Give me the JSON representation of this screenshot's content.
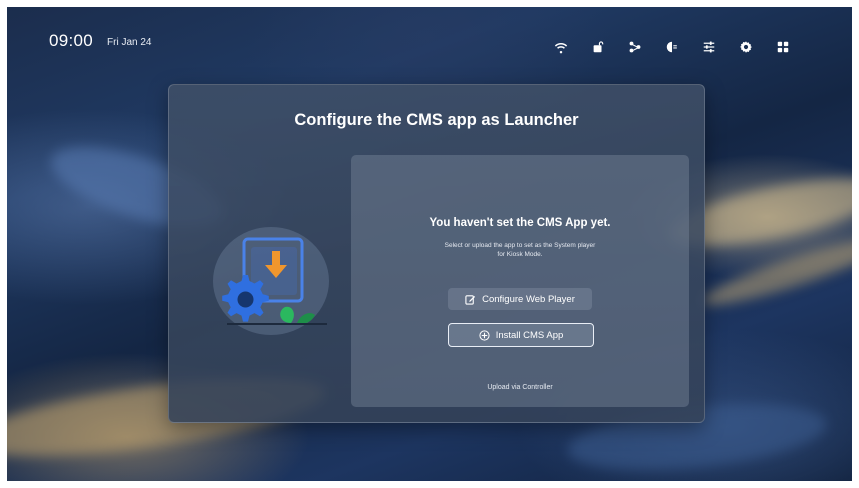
{
  "status_bar": {
    "time": "09:00",
    "date": "Fri Jan 24",
    "icons": [
      "wifi-icon",
      "usb-lock-icon",
      "share-icon",
      "input-source-icon",
      "sliders-icon",
      "settings-icon",
      "apps-grid-icon"
    ]
  },
  "dialog": {
    "title": "Configure the CMS app as Launcher",
    "panel": {
      "heading": "You haven't set the CMS App yet.",
      "description_line1": "Select or upload the app to set as the System player",
      "description_line2": "for Kiosk Mode.",
      "configure_button": "Configure Web Player",
      "install_button": "Install CMS App",
      "upload_link": "Upload via Controller"
    }
  },
  "colors": {
    "accent_orange": "#f0962d",
    "gear_blue": "#2f6fe0",
    "leaf_green": "#2bb85f"
  }
}
